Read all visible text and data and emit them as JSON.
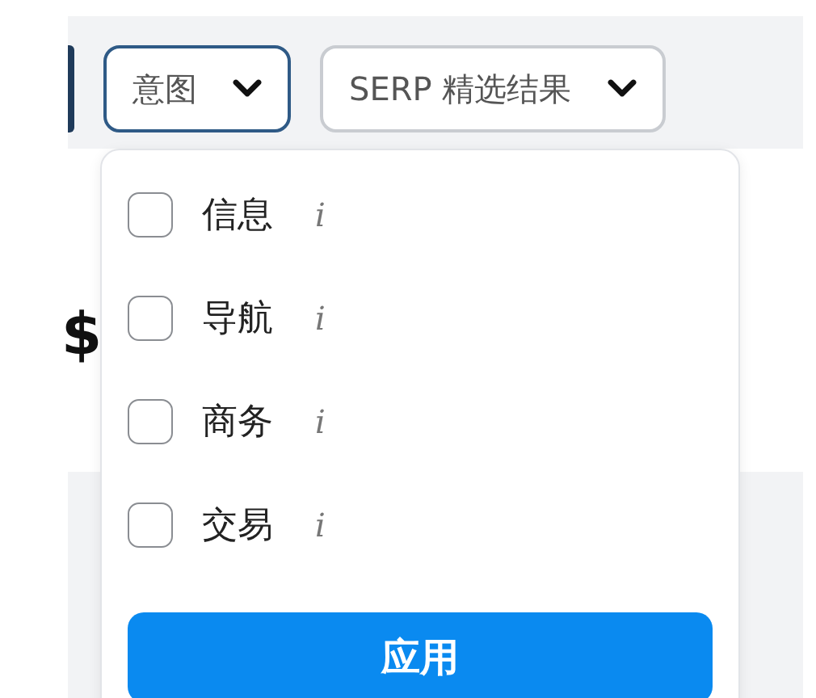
{
  "filters": [
    {
      "label": "意图",
      "open": true
    },
    {
      "label": "SERP 精选结果",
      "open": false
    }
  ],
  "background_card": {
    "value_text": "$"
  },
  "dropdown": {
    "options": [
      {
        "label": "信息",
        "info": "i",
        "checked": false
      },
      {
        "label": "导航",
        "info": "i",
        "checked": false
      },
      {
        "label": "商务",
        "info": "i",
        "checked": false
      },
      {
        "label": "交易",
        "info": "i",
        "checked": false
      }
    ],
    "apply_button": "应用"
  }
}
